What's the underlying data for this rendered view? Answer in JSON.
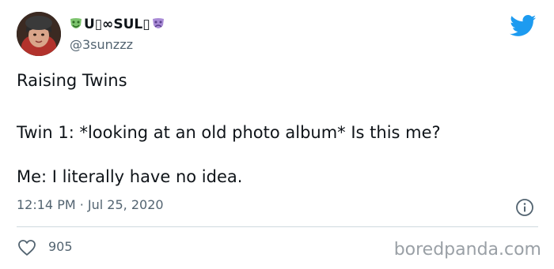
{
  "tweet": {
    "display_name": "U▯∞SUL▯",
    "handle": "@3sunzzz",
    "text_lines": [
      "Raising Twins",
      "Twin 1: *looking at an old photo album* Is this me?",
      "Me: I literally have no idea."
    ],
    "timestamp": "12:14 PM · Jul 25, 2020",
    "like_count": "905"
  },
  "watermark": "boredpanda.com",
  "icons": {
    "mask_left": "green-comedy-mask-icon",
    "mask_right": "purple-tragedy-mask-icon",
    "brand": "twitter-bird-icon",
    "info": "info-icon",
    "like": "heart-icon"
  },
  "colors": {
    "twitter_blue": "#1d9bf0",
    "text_primary": "#0f1419",
    "text_secondary": "#536471",
    "divider": "#cfd9de",
    "mask_green": "#7cc36d",
    "mask_purple": "#a98bd6"
  }
}
